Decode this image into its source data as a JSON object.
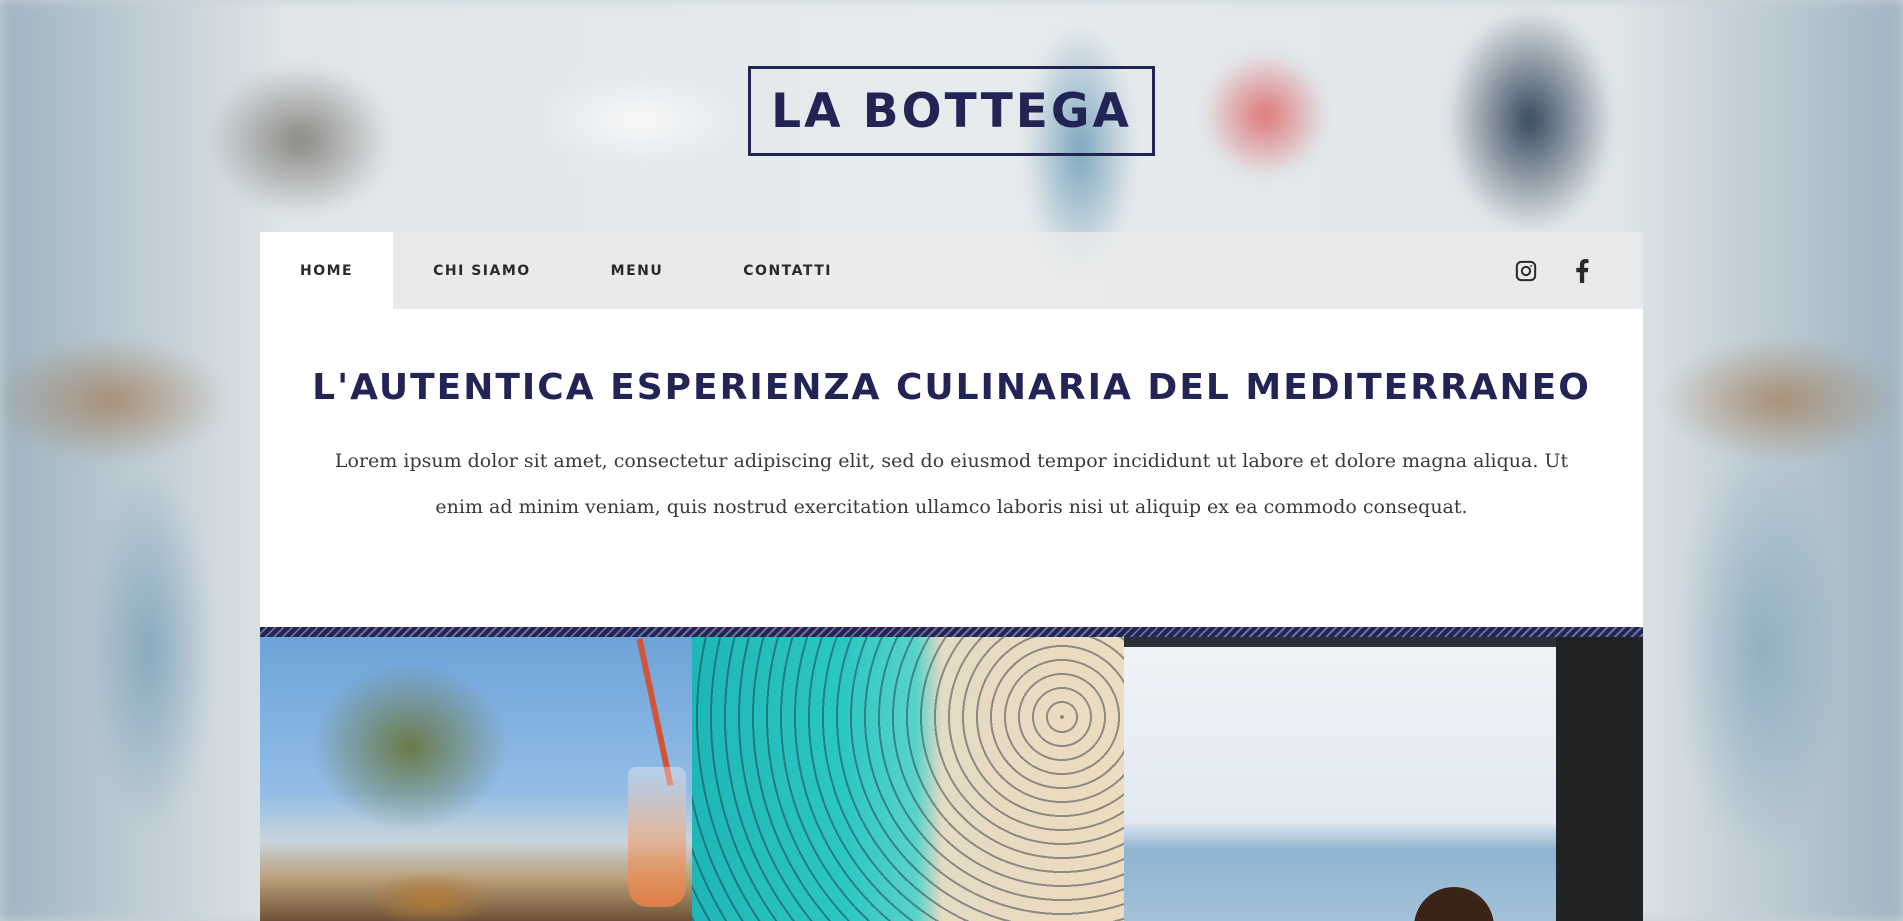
{
  "brand": {
    "name": "LA BOTTEGA",
    "color": "#232456"
  },
  "nav": {
    "items": [
      {
        "label": "HOME",
        "active": true
      },
      {
        "label": "CHI SIAMO",
        "active": false
      },
      {
        "label": "MENU",
        "active": false
      },
      {
        "label": "CONTATTI",
        "active": false
      }
    ],
    "social": [
      "instagram-icon",
      "facebook-icon"
    ]
  },
  "intro": {
    "headline": "L'AUTENTICA ESPERIENZA CULINARIA DEL MEDITERRANEO",
    "body": "Lorem ipsum dolor sit amet, consectetur adipiscing elit, sed do eiusmod tempor incididunt ut labore et dolore magna aliqua. Ut enim ad minim veniam, quis nostrud exercitation ullamco laboris nisi ut aliquip ex ea commodo consequat."
  }
}
